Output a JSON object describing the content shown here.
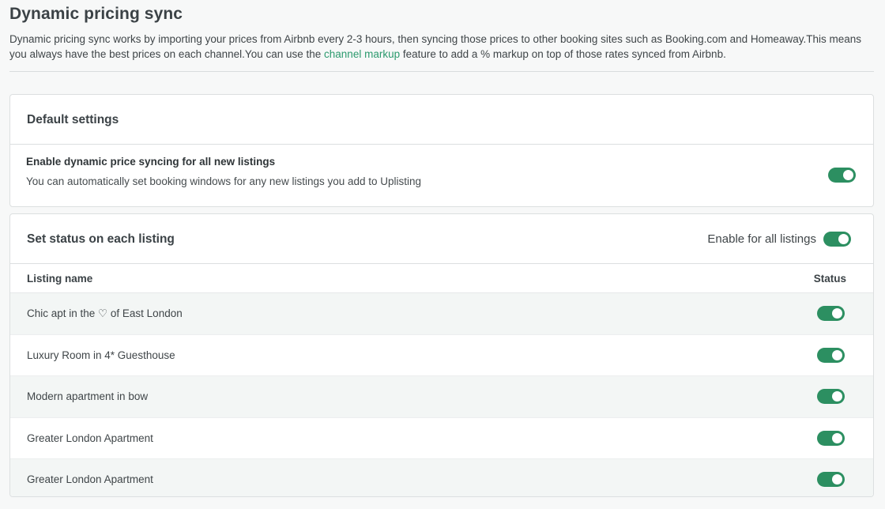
{
  "page": {
    "title": "Dynamic pricing sync",
    "description_part1": "Dynamic pricing sync works by importing your prices from Airbnb every 2-3 hours, then syncing those prices to other booking sites such as Booking.com and Homeaway.This means you always have the best prices on each channel.You can use the ",
    "description_link": "channel markup",
    "description_part2": " feature to add a % markup on top of those rates synced from Airbnb."
  },
  "default_settings": {
    "heading": "Default settings",
    "setting_title": "Enable dynamic price syncing for all new listings",
    "setting_subtitle": "You can automatically set booking windows for any new listings you add to Uplisting",
    "enabled": true
  },
  "status_section": {
    "heading": "Set status on each listing",
    "enable_all_label": "Enable for all listings",
    "enable_all": true,
    "columns": {
      "name": "Listing name",
      "status": "Status"
    },
    "listings": [
      {
        "name": "Chic apt in the ♡ of East London",
        "enabled": true
      },
      {
        "name": "Luxury Room in 4* Guesthouse",
        "enabled": true
      },
      {
        "name": "Modern apartment in bow",
        "enabled": true
      },
      {
        "name": "Greater London Apartment",
        "enabled": true
      },
      {
        "name": "Greater London Apartment",
        "enabled": true
      }
    ]
  },
  "colors": {
    "accent": "#2c8f61",
    "link": "#2c9a6e"
  }
}
